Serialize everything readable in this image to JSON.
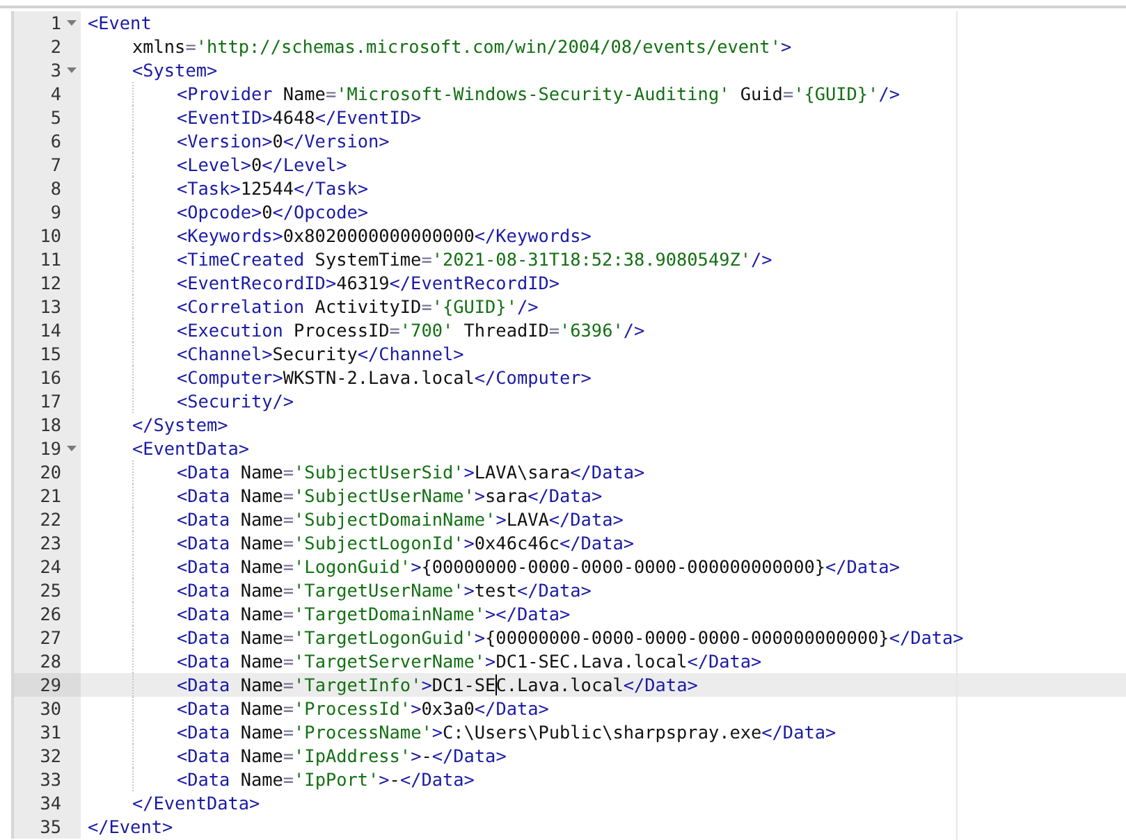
{
  "lines": [
    {
      "number": "1",
      "expanded": true,
      "selected": false,
      "tokens": [
        {
          "kind": "tag",
          "text": "<Event"
        }
      ],
      "children": [
        {
          "number": "2",
          "selected": false,
          "tokens": [
            {
              "kind": "attr",
              "text": "xmlns"
            },
            {
              "kind": "eq",
              "text": "="
            },
            {
              "kind": "value",
              "text": "'http://schemas.microsoft.com/win/2004/08/events/event'"
            },
            {
              "kind": "tag",
              "text": ">"
            }
          ]
        },
        {
          "number": "3",
          "expanded": true,
          "selected": false,
          "tokens": [
            {
              "kind": "tag",
              "text": "<System>"
            }
          ],
          "children": [
            {
              "number": "4",
              "selected": false,
              "tokens": [
                {
                  "kind": "tag",
                  "text": "<Provider"
                },
                {
                  "kind": "attr",
                  "text": " Name"
                },
                {
                  "kind": "eq",
                  "text": "="
                },
                {
                  "kind": "value",
                  "text": "'Microsoft-Windows-Security-Auditing'"
                },
                {
                  "kind": "attr",
                  "text": " Guid"
                },
                {
                  "kind": "eq",
                  "text": "="
                },
                {
                  "kind": "value",
                  "text": "'{GUID}'"
                },
                {
                  "kind": "tag",
                  "text": "/>"
                }
              ]
            },
            {
              "number": "5",
              "selected": false,
              "tokens": [
                {
                  "kind": "tag",
                  "text": "<EventID>"
                },
                {
                  "kind": "text",
                  "text": "4648"
                },
                {
                  "kind": "tag",
                  "text": "</EventID>"
                }
              ]
            },
            {
              "number": "6",
              "selected": false,
              "tokens": [
                {
                  "kind": "tag",
                  "text": "<Version>"
                },
                {
                  "kind": "text",
                  "text": "0"
                },
                {
                  "kind": "tag",
                  "text": "</Version>"
                }
              ]
            },
            {
              "number": "7",
              "selected": false,
              "tokens": [
                {
                  "kind": "tag",
                  "text": "<Level>"
                },
                {
                  "kind": "text",
                  "text": "0"
                },
                {
                  "kind": "tag",
                  "text": "</Level>"
                }
              ]
            },
            {
              "number": "8",
              "selected": false,
              "tokens": [
                {
                  "kind": "tag",
                  "text": "<Task>"
                },
                {
                  "kind": "text",
                  "text": "12544"
                },
                {
                  "kind": "tag",
                  "text": "</Task>"
                }
              ]
            },
            {
              "number": "9",
              "selected": false,
              "tokens": [
                {
                  "kind": "tag",
                  "text": "<Opcode>"
                },
                {
                  "kind": "text",
                  "text": "0"
                },
                {
                  "kind": "tag",
                  "text": "</Opcode>"
                }
              ]
            },
            {
              "number": "10",
              "selected": false,
              "tokens": [
                {
                  "kind": "tag",
                  "text": "<Keywords>"
                },
                {
                  "kind": "text",
                  "text": "0x8020000000000000"
                },
                {
                  "kind": "tag",
                  "text": "</Keywords>"
                }
              ]
            },
            {
              "number": "11",
              "selected": false,
              "tokens": [
                {
                  "kind": "tag",
                  "text": "<TimeCreated"
                },
                {
                  "kind": "attr",
                  "text": " SystemTime"
                },
                {
                  "kind": "eq",
                  "text": "="
                },
                {
                  "kind": "value",
                  "text": "'2021-08-31T18:52:38.9080549Z'"
                },
                {
                  "kind": "tag",
                  "text": "/>"
                }
              ]
            },
            {
              "number": "12",
              "selected": false,
              "tokens": [
                {
                  "kind": "tag",
                  "text": "<EventRecordID>"
                },
                {
                  "kind": "text",
                  "text": "46319"
                },
                {
                  "kind": "tag",
                  "text": "</EventRecordID>"
                }
              ]
            },
            {
              "number": "13",
              "selected": false,
              "tokens": [
                {
                  "kind": "tag",
                  "text": "<Correlation"
                },
                {
                  "kind": "attr",
                  "text": " ActivityID"
                },
                {
                  "kind": "eq",
                  "text": "="
                },
                {
                  "kind": "value",
                  "text": "'{GUID}'"
                },
                {
                  "kind": "tag",
                  "text": "/>"
                }
              ]
            },
            {
              "number": "14",
              "selected": false,
              "tokens": [
                {
                  "kind": "tag",
                  "text": "<Execution"
                },
                {
                  "kind": "attr",
                  "text": " ProcessID"
                },
                {
                  "kind": "eq",
                  "text": "="
                },
                {
                  "kind": "value",
                  "text": "'700'"
                },
                {
                  "kind": "attr",
                  "text": " ThreadID"
                },
                {
                  "kind": "eq",
                  "text": "="
                },
                {
                  "kind": "value",
                  "text": "'6396'"
                },
                {
                  "kind": "tag",
                  "text": "/>"
                }
              ]
            },
            {
              "number": "15",
              "selected": false,
              "tokens": [
                {
                  "kind": "tag",
                  "text": "<Channel>"
                },
                {
                  "kind": "text",
                  "text": "Security"
                },
                {
                  "kind": "tag",
                  "text": "</Channel>"
                }
              ]
            },
            {
              "number": "16",
              "selected": false,
              "tokens": [
                {
                  "kind": "tag",
                  "text": "<Computer>"
                },
                {
                  "kind": "text",
                  "text": "WKSTN-2.Lava.local"
                },
                {
                  "kind": "tag",
                  "text": "</Computer>"
                }
              ]
            },
            {
              "number": "17",
              "selected": false,
              "tokens": [
                {
                  "kind": "tag",
                  "text": "<Security/>"
                }
              ]
            }
          ]
        },
        {
          "number": "18",
          "selected": false,
          "tokens": [
            {
              "kind": "tag",
              "text": "</System>"
            }
          ]
        },
        {
          "number": "19",
          "expanded": true,
          "selected": false,
          "tokens": [
            {
              "kind": "tag",
              "text": "<EventData>"
            }
          ],
          "children": [
            {
              "number": "20",
              "selected": false,
              "tokens": [
                {
                  "kind": "tag",
                  "text": "<Data"
                },
                {
                  "kind": "attr",
                  "text": " Name"
                },
                {
                  "kind": "eq",
                  "text": "="
                },
                {
                  "kind": "value",
                  "text": "'SubjectUserSid'"
                },
                {
                  "kind": "tag",
                  "text": ">"
                },
                {
                  "kind": "text",
                  "text": "LAVA\\sara"
                },
                {
                  "kind": "tag",
                  "text": "</Data>"
                }
              ]
            },
            {
              "number": "21",
              "selected": false,
              "tokens": [
                {
                  "kind": "tag",
                  "text": "<Data"
                },
                {
                  "kind": "attr",
                  "text": " Name"
                },
                {
                  "kind": "eq",
                  "text": "="
                },
                {
                  "kind": "value",
                  "text": "'SubjectUserName'"
                },
                {
                  "kind": "tag",
                  "text": ">"
                },
                {
                  "kind": "text",
                  "text": "sara"
                },
                {
                  "kind": "tag",
                  "text": "</Data>"
                }
              ]
            },
            {
              "number": "22",
              "selected": false,
              "tokens": [
                {
                  "kind": "tag",
                  "text": "<Data"
                },
                {
                  "kind": "attr",
                  "text": " Name"
                },
                {
                  "kind": "eq",
                  "text": "="
                },
                {
                  "kind": "value",
                  "text": "'SubjectDomainName'"
                },
                {
                  "kind": "tag",
                  "text": ">"
                },
                {
                  "kind": "text",
                  "text": "LAVA"
                },
                {
                  "kind": "tag",
                  "text": "</Data>"
                }
              ]
            },
            {
              "number": "23",
              "selected": false,
              "tokens": [
                {
                  "kind": "tag",
                  "text": "<Data"
                },
                {
                  "kind": "attr",
                  "text": " Name"
                },
                {
                  "kind": "eq",
                  "text": "="
                },
                {
                  "kind": "value",
                  "text": "'SubjectLogonId'"
                },
                {
                  "kind": "tag",
                  "text": ">"
                },
                {
                  "kind": "text",
                  "text": "0x46c46c"
                },
                {
                  "kind": "tag",
                  "text": "</Data>"
                }
              ]
            },
            {
              "number": "24",
              "selected": false,
              "tokens": [
                {
                  "kind": "tag",
                  "text": "<Data"
                },
                {
                  "kind": "attr",
                  "text": " Name"
                },
                {
                  "kind": "eq",
                  "text": "="
                },
                {
                  "kind": "value",
                  "text": "'LogonGuid'"
                },
                {
                  "kind": "tag",
                  "text": ">"
                },
                {
                  "kind": "text",
                  "text": "{00000000-0000-0000-0000-000000000000}"
                },
                {
                  "kind": "tag",
                  "text": "</Data>"
                }
              ]
            },
            {
              "number": "25",
              "selected": false,
              "tokens": [
                {
                  "kind": "tag",
                  "text": "<Data"
                },
                {
                  "kind": "attr",
                  "text": " Name"
                },
                {
                  "kind": "eq",
                  "text": "="
                },
                {
                  "kind": "value",
                  "text": "'TargetUserName'"
                },
                {
                  "kind": "tag",
                  "text": ">"
                },
                {
                  "kind": "text",
                  "text": "test"
                },
                {
                  "kind": "tag",
                  "text": "</Data>"
                }
              ]
            },
            {
              "number": "26",
              "selected": false,
              "tokens": [
                {
                  "kind": "tag",
                  "text": "<Data"
                },
                {
                  "kind": "attr",
                  "text": " Name"
                },
                {
                  "kind": "eq",
                  "text": "="
                },
                {
                  "kind": "value",
                  "text": "'TargetDomainName'"
                },
                {
                  "kind": "tag",
                  "text": "></Data>"
                }
              ]
            },
            {
              "number": "27",
              "selected": false,
              "tokens": [
                {
                  "kind": "tag",
                  "text": "<Data"
                },
                {
                  "kind": "attr",
                  "text": " Name"
                },
                {
                  "kind": "eq",
                  "text": "="
                },
                {
                  "kind": "value",
                  "text": "'TargetLogonGuid'"
                },
                {
                  "kind": "tag",
                  "text": ">"
                },
                {
                  "kind": "text",
                  "text": "{00000000-0000-0000-0000-000000000000}"
                },
                {
                  "kind": "tag",
                  "text": "</Data>"
                }
              ]
            },
            {
              "number": "28",
              "selected": false,
              "tokens": [
                {
                  "kind": "tag",
                  "text": "<Data"
                },
                {
                  "kind": "attr",
                  "text": " Name"
                },
                {
                  "kind": "eq",
                  "text": "="
                },
                {
                  "kind": "value",
                  "text": "'TargetServerName'"
                },
                {
                  "kind": "tag",
                  "text": ">"
                },
                {
                  "kind": "text",
                  "text": "DC1-SEC.Lava.local"
                },
                {
                  "kind": "tag",
                  "text": "</Data>"
                }
              ]
            },
            {
              "number": "29",
              "selected": true,
              "tokens": [
                {
                  "kind": "tag",
                  "text": "<Data"
                },
                {
                  "kind": "attr",
                  "text": " Name"
                },
                {
                  "kind": "eq",
                  "text": "="
                },
                {
                  "kind": "value",
                  "text": "'TargetInfo'"
                },
                {
                  "kind": "tag",
                  "text": ">"
                },
                {
                  "kind": "text",
                  "text": "DC1-SE"
                },
                {
                  "kind": "cursor"
                },
                {
                  "kind": "text",
                  "text": "C.Lava.local"
                },
                {
                  "kind": "tag",
                  "text": "</Data>"
                }
              ]
            },
            {
              "number": "30",
              "selected": false,
              "tokens": [
                {
                  "kind": "tag",
                  "text": "<Data"
                },
                {
                  "kind": "attr",
                  "text": " Name"
                },
                {
                  "kind": "eq",
                  "text": "="
                },
                {
                  "kind": "value",
                  "text": "'ProcessId'"
                },
                {
                  "kind": "tag",
                  "text": ">"
                },
                {
                  "kind": "text",
                  "text": "0x3a0"
                },
                {
                  "kind": "tag",
                  "text": "</Data>"
                }
              ]
            },
            {
              "number": "31",
              "selected": false,
              "tokens": [
                {
                  "kind": "tag",
                  "text": "<Data"
                },
                {
                  "kind": "attr",
                  "text": " Name"
                },
                {
                  "kind": "eq",
                  "text": "="
                },
                {
                  "kind": "value",
                  "text": "'ProcessName'"
                },
                {
                  "kind": "tag",
                  "text": ">"
                },
                {
                  "kind": "text",
                  "text": "C:\\Users\\Public\\sharpspray.exe"
                },
                {
                  "kind": "tag",
                  "text": "</Data>"
                }
              ]
            },
            {
              "number": "32",
              "selected": false,
              "tokens": [
                {
                  "kind": "tag",
                  "text": "<Data"
                },
                {
                  "kind": "attr",
                  "text": " Name"
                },
                {
                  "kind": "eq",
                  "text": "="
                },
                {
                  "kind": "value",
                  "text": "'IpAddress'"
                },
                {
                  "kind": "tag",
                  "text": ">"
                },
                {
                  "kind": "text",
                  "text": "-"
                },
                {
                  "kind": "tag",
                  "text": "</Data>"
                }
              ]
            },
            {
              "number": "33",
              "selected": false,
              "tokens": [
                {
                  "kind": "tag",
                  "text": "<Data"
                },
                {
                  "kind": "attr",
                  "text": " Name"
                },
                {
                  "kind": "eq",
                  "text": "="
                },
                {
                  "kind": "value",
                  "text": "'IpPort'"
                },
                {
                  "kind": "tag",
                  "text": ">"
                },
                {
                  "kind": "text",
                  "text": "-"
                },
                {
                  "kind": "tag",
                  "text": "</Data>"
                }
              ]
            }
          ]
        },
        {
          "number": "34",
          "selected": false,
          "tokens": [
            {
              "kind": "tag",
              "text": "</EventData>"
            }
          ]
        }
      ]
    },
    {
      "number": "35",
      "selected": false,
      "tokens": [
        {
          "kind": "tag",
          "text": "</Event>"
        }
      ]
    }
  ]
}
